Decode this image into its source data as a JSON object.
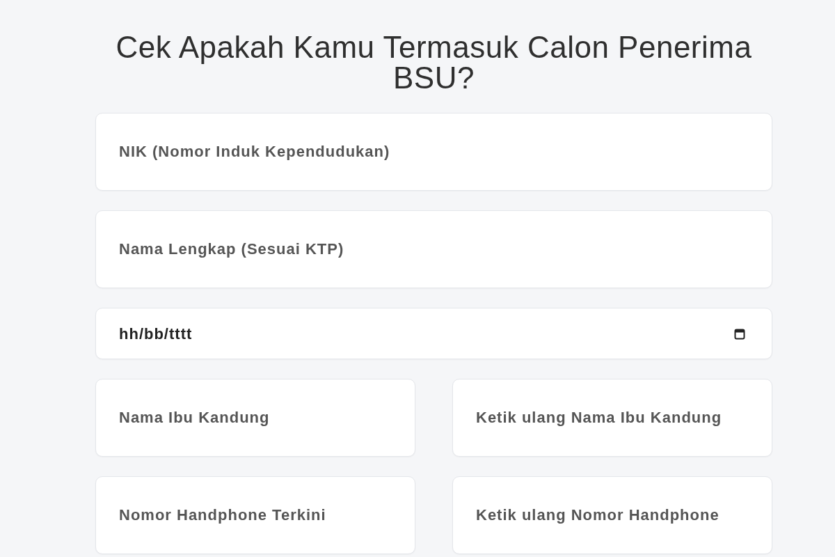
{
  "title": "Cek Apakah Kamu Termasuk Calon Penerima BSU?",
  "rows": [
    {
      "fields": [
        {
          "kind": "text",
          "placeholder": "NIK (Nomor Induk Kependudukan)"
        }
      ]
    },
    {
      "fields": [
        {
          "kind": "text",
          "placeholder": "Nama Lengkap (Sesuai KTP)"
        }
      ]
    },
    {
      "fields": [
        {
          "kind": "date",
          "value": "hh/bb/tttt"
        }
      ]
    },
    {
      "fields": [
        {
          "kind": "text",
          "placeholder": "Nama Ibu Kandung"
        },
        {
          "kind": "text",
          "placeholder": "Ketik ulang Nama Ibu Kandung"
        }
      ]
    },
    {
      "fields": [
        {
          "kind": "text",
          "placeholder": "Nomor Handphone Terkini"
        },
        {
          "kind": "text",
          "placeholder": "Ketik ulang Nomor Handphone"
        }
      ]
    }
  ]
}
